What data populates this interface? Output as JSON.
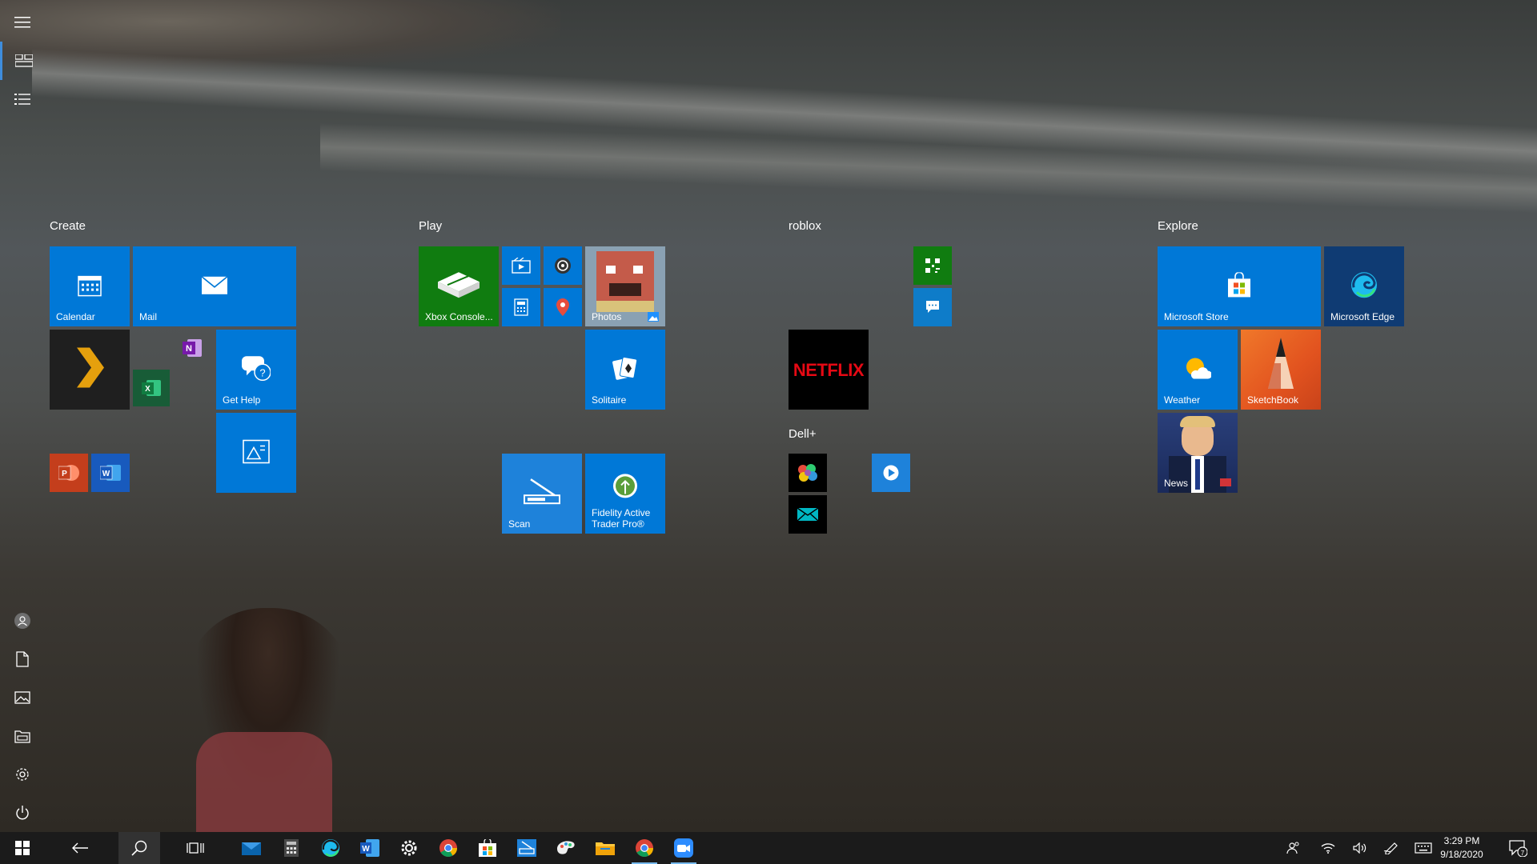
{
  "groups": {
    "create": "Create",
    "play": "Play",
    "roblox": "roblox",
    "explore": "Explore",
    "dell": "Dell+"
  },
  "tiles": {
    "calendar": "Calendar",
    "mail": "Mail",
    "get_help": "Get Help",
    "xbox": "Xbox Console...",
    "photos": "Photos",
    "solitaire": "Solitaire",
    "scan": "Scan",
    "fidelity": "Fidelity Active Trader Pro®",
    "netflix": "NETFLIX",
    "microsoft_store": "Microsoft Store",
    "microsoft_edge": "Microsoft Edge",
    "weather": "Weather",
    "sketchbook": "SketchBook",
    "news": "News"
  },
  "clock": {
    "time": "3:29 PM",
    "date": "9/18/2020"
  },
  "notifications": {
    "count": "7"
  },
  "colors": {
    "tile_blue": "#0078d7",
    "xbox_green": "#107c10",
    "taskbar": "#1b1b1b",
    "accent": "#3e8ddd"
  }
}
